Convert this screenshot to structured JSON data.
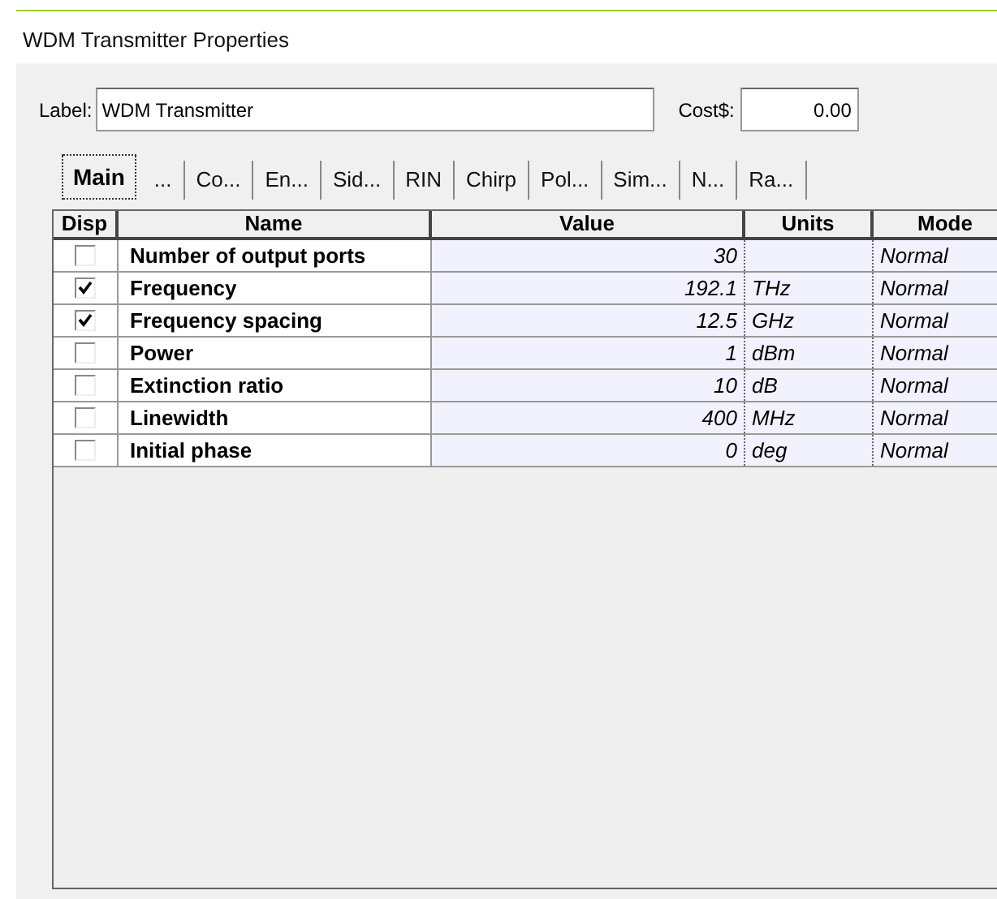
{
  "window": {
    "title": "WDM Transmitter Properties"
  },
  "label_field": {
    "label": "Label:",
    "value": "WDM Transmitter"
  },
  "cost_field": {
    "label": "Cost$:",
    "value": "0.00"
  },
  "tabs": [
    {
      "label": "Main",
      "selected": true
    },
    {
      "label": "...",
      "selected": false
    },
    {
      "label": "Co...",
      "selected": false
    },
    {
      "label": "En...",
      "selected": false
    },
    {
      "label": "Sid...",
      "selected": false
    },
    {
      "label": "RIN",
      "selected": false
    },
    {
      "label": "Chirp",
      "selected": false
    },
    {
      "label": "Pol...",
      "selected": false
    },
    {
      "label": "Sim...",
      "selected": false
    },
    {
      "label": "N...",
      "selected": false
    },
    {
      "label": "Ra...",
      "selected": false
    }
  ],
  "table": {
    "columns": [
      "Disp",
      "Name",
      "Value",
      "Units",
      "Mode"
    ],
    "rows": [
      {
        "checked": false,
        "name": "Number of output ports",
        "value": "30",
        "mode": "Normal"
      },
      {
        "checked": true,
        "name": "Frequency",
        "value": "192.1",
        "units": "THz",
        "mode": "Normal"
      },
      {
        "checked": true,
        "name": "Frequency spacing",
        "value": "12.5",
        "units": "GHz",
        "mode": "Normal"
      },
      {
        "checked": false,
        "name": "Power",
        "value": "1",
        "units": "dBm",
        "mode": "Normal"
      },
      {
        "checked": false,
        "name": "Extinction ratio",
        "value": "10",
        "units": "dB",
        "mode": "Normal"
      },
      {
        "checked": false,
        "name": "Linewidth",
        "value": "400",
        "units": "MHz",
        "mode": "Normal"
      },
      {
        "checked": false,
        "name": "Initial phase",
        "value": "0",
        "units": "deg",
        "mode": "Normal"
      }
    ]
  }
}
